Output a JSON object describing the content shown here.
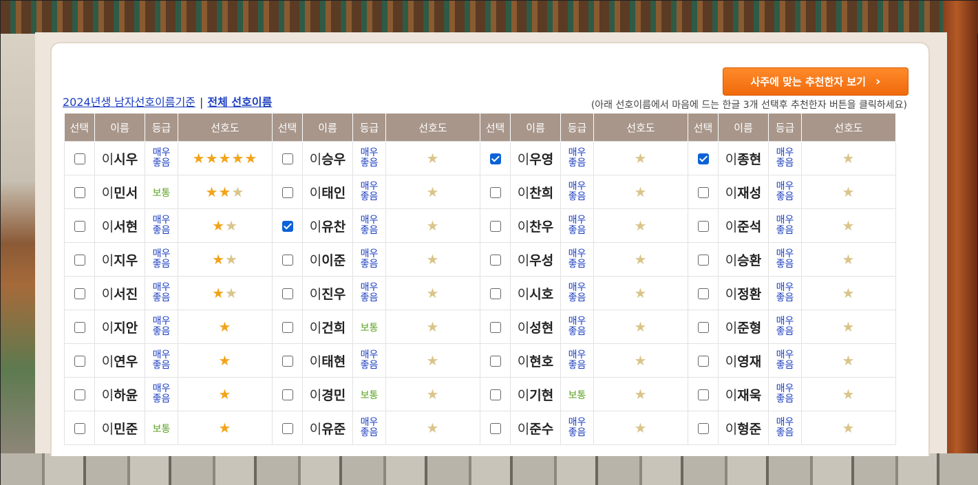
{
  "cta_button": {
    "label": "사주에 맞는 추천한자 보기",
    "chevron": "›"
  },
  "links": {
    "year_link": "2024년생 남자선호이름기준",
    "separator": "|",
    "all_link": "전체 선호이름"
  },
  "hint": "(아래 선호이름에서 마음에 드는 한글 3개 선택후 추천한자 버튼을 클릭하세요)",
  "table": {
    "headers": [
      "선택",
      "이름",
      "등급",
      "선호도"
    ],
    "surname": "이",
    "rows": [
      [
        {
          "checked": false,
          "given": "시우",
          "grade": "매우 좋음",
          "stars": "★★★★★",
          "half": ""
        },
        {
          "checked": false,
          "given": "승우",
          "grade": "매우 좋음",
          "stars": "",
          "half": "★"
        },
        {
          "checked": true,
          "given": "우영",
          "grade": "매우 좋음",
          "stars": "",
          "half": "★"
        },
        {
          "checked": true,
          "given": "종현",
          "grade": "매우 좋음",
          "stars": "",
          "half": "★"
        }
      ],
      [
        {
          "checked": false,
          "given": "민서",
          "grade": "보통",
          "stars": "★★",
          "half": "★"
        },
        {
          "checked": false,
          "given": "태인",
          "grade": "매우 좋음",
          "stars": "",
          "half": "★"
        },
        {
          "checked": false,
          "given": "찬희",
          "grade": "매우 좋음",
          "stars": "",
          "half": "★"
        },
        {
          "checked": false,
          "given": "재성",
          "grade": "매우 좋음",
          "stars": "",
          "half": "★"
        }
      ],
      [
        {
          "checked": false,
          "given": "서현",
          "grade": "매우 좋음",
          "stars": "★",
          "half": "★"
        },
        {
          "checked": true,
          "given": "유찬",
          "grade": "매우 좋음",
          "stars": "",
          "half": "★"
        },
        {
          "checked": false,
          "given": "찬우",
          "grade": "매우 좋음",
          "stars": "",
          "half": "★"
        },
        {
          "checked": false,
          "given": "준석",
          "grade": "매우 좋음",
          "stars": "",
          "half": "★"
        }
      ],
      [
        {
          "checked": false,
          "given": "지우",
          "grade": "매우 좋음",
          "stars": "★",
          "half": "★"
        },
        {
          "checked": false,
          "given": "이준",
          "grade": "매우 좋음",
          "stars": "",
          "half": "★"
        },
        {
          "checked": false,
          "given": "우성",
          "grade": "매우 좋음",
          "stars": "",
          "half": "★"
        },
        {
          "checked": false,
          "given": "승환",
          "grade": "매우 좋음",
          "stars": "",
          "half": "★"
        }
      ],
      [
        {
          "checked": false,
          "given": "서진",
          "grade": "매우 좋음",
          "stars": "★",
          "half": "★"
        },
        {
          "checked": false,
          "given": "진우",
          "grade": "매우 좋음",
          "stars": "",
          "half": "★"
        },
        {
          "checked": false,
          "given": "시호",
          "grade": "매우 좋음",
          "stars": "",
          "half": "★"
        },
        {
          "checked": false,
          "given": "정환",
          "grade": "매우 좋음",
          "stars": "",
          "half": "★"
        }
      ],
      [
        {
          "checked": false,
          "given": "지안",
          "grade": "매우 좋음",
          "stars": "★",
          "half": ""
        },
        {
          "checked": false,
          "given": "건희",
          "grade": "보통",
          "stars": "",
          "half": "★"
        },
        {
          "checked": false,
          "given": "성현",
          "grade": "매우 좋음",
          "stars": "",
          "half": "★"
        },
        {
          "checked": false,
          "given": "준형",
          "grade": "매우 좋음",
          "stars": "",
          "half": "★"
        }
      ],
      [
        {
          "checked": false,
          "given": "연우",
          "grade": "매우 좋음",
          "stars": "★",
          "half": ""
        },
        {
          "checked": false,
          "given": "태현",
          "grade": "매우 좋음",
          "stars": "",
          "half": "★"
        },
        {
          "checked": false,
          "given": "현호",
          "grade": "매우 좋음",
          "stars": "",
          "half": "★"
        },
        {
          "checked": false,
          "given": "영재",
          "grade": "매우 좋음",
          "stars": "",
          "half": "★"
        }
      ],
      [
        {
          "checked": false,
          "given": "하윤",
          "grade": "매우 좋음",
          "stars": "★",
          "half": ""
        },
        {
          "checked": false,
          "given": "경민",
          "grade": "보통",
          "stars": "",
          "half": "★"
        },
        {
          "checked": false,
          "given": "기현",
          "grade": "보통",
          "stars": "",
          "half": "★"
        },
        {
          "checked": false,
          "given": "재욱",
          "grade": "매우 좋음",
          "stars": "",
          "half": "★"
        }
      ],
      [
        {
          "checked": false,
          "given": "민준",
          "grade": "보통",
          "stars": "★",
          "half": ""
        },
        {
          "checked": false,
          "given": "유준",
          "grade": "매우 좋음",
          "stars": "",
          "half": "★"
        },
        {
          "checked": false,
          "given": "준수",
          "grade": "매우 좋음",
          "stars": "",
          "half": "★"
        },
        {
          "checked": false,
          "given": "형준",
          "grade": "매우 좋음",
          "stars": "",
          "half": "★"
        }
      ]
    ]
  },
  "colors": {
    "accent": "#f06a0c",
    "header_bg": "#a8968a",
    "link": "#1a3dbf",
    "grade_good": "#1a3dbf",
    "grade_normal": "#5aa020",
    "star": "#f2a317"
  }
}
